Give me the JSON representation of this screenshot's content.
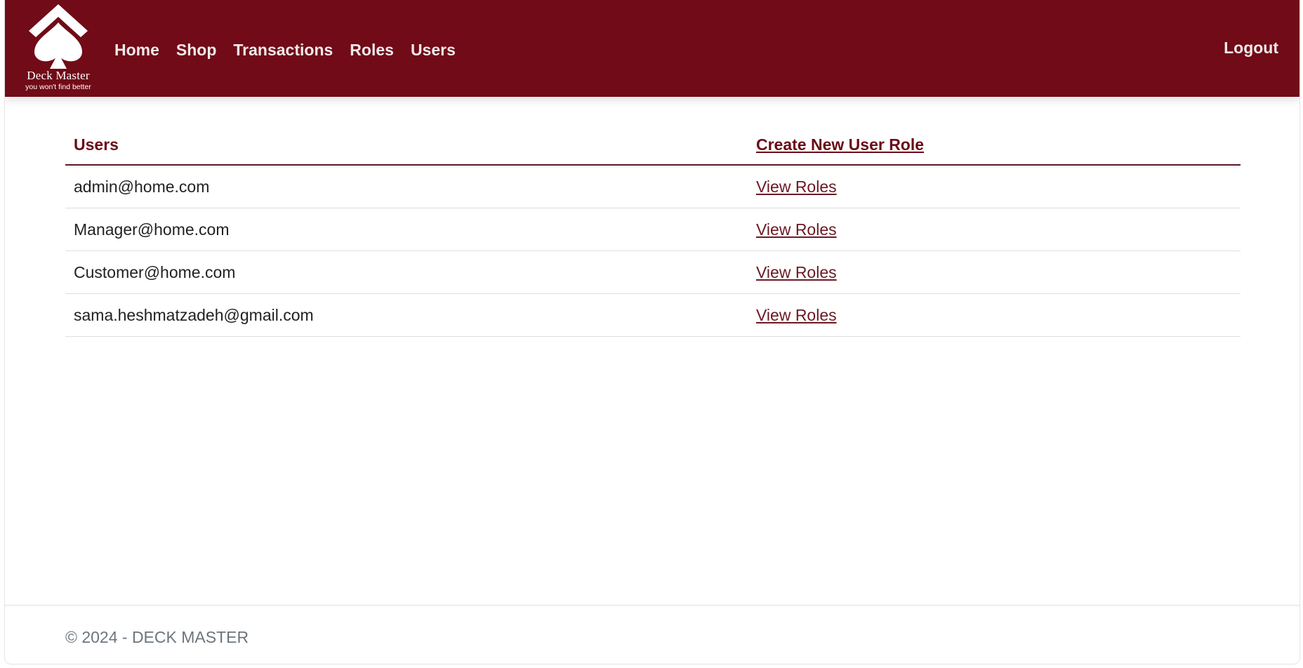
{
  "brand": {
    "title": "Deck Master",
    "tagline": "you won't find better",
    "colors": {
      "navbar": "#700b17",
      "link": "#6b0b16",
      "footer_text": "#6c757d"
    },
    "logo_icon": "spade-icon"
  },
  "nav": {
    "items": [
      {
        "label": "Home"
      },
      {
        "label": "Shop"
      },
      {
        "label": "Transactions"
      },
      {
        "label": "Roles"
      },
      {
        "label": "Users"
      }
    ],
    "logout_label": "Logout"
  },
  "users_table": {
    "headers": {
      "users": "Users",
      "create_role": "Create New User Role"
    },
    "rows": [
      {
        "email": "admin@home.com",
        "action": "View Roles"
      },
      {
        "email": "Manager@home.com",
        "action": "View Roles"
      },
      {
        "email": "Customer@home.com",
        "action": "View Roles"
      },
      {
        "email": "sama.heshmatzadeh@gmail.com",
        "action": "View Roles"
      }
    ]
  },
  "footer": {
    "text": "© 2024 - DECK MASTER"
  }
}
